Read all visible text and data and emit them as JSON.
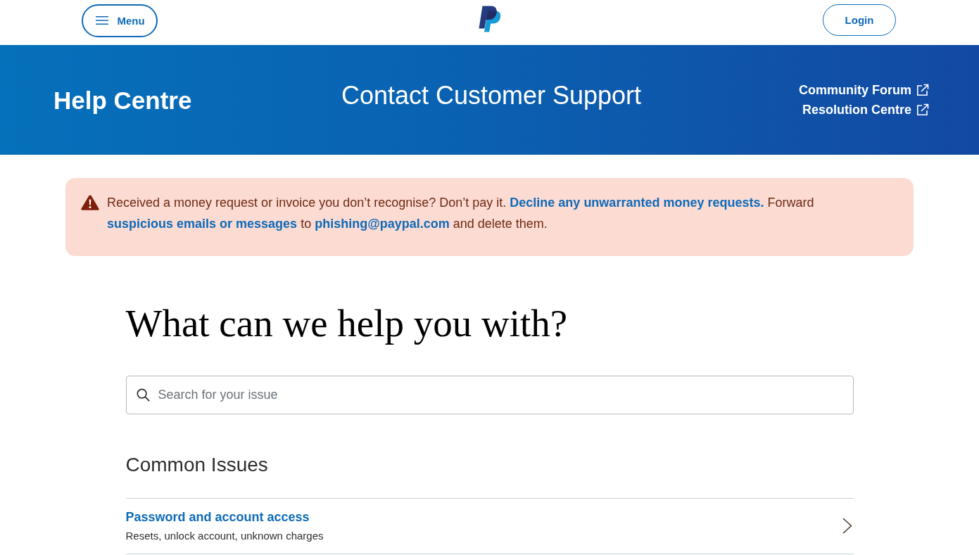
{
  "header": {
    "menu_button": {
      "label": "Menu"
    },
    "login_button": {
      "label": "Login"
    }
  },
  "banner": {
    "title": "Help Centre",
    "subtitle": "Contact Customer Support",
    "links": [
      {
        "label": "Community Forum"
      },
      {
        "label": "Resolution Centre"
      }
    ]
  },
  "alert": {
    "parts": [
      {
        "kind": "text",
        "text": "Received a money request or invoice you don’t recognise? Don’t pay it. "
      },
      {
        "kind": "link",
        "text": "Decline any unwarranted money requests."
      },
      {
        "kind": "text",
        "text": " Forward "
      },
      {
        "kind": "link",
        "text": "suspicious emails or messages"
      },
      {
        "kind": "text",
        "text": " to "
      },
      {
        "kind": "link",
        "text": "phishing@paypal.com"
      },
      {
        "kind": "text",
        "text": " and delete them."
      }
    ]
  },
  "heading": "What can we help you with?",
  "search": {
    "placeholder": "Search for your issue"
  },
  "common_issues": {
    "title": "Common Issues",
    "items": [
      {
        "title": "Password and account access",
        "description": "Resets, unlock account, unknown charges"
      }
    ]
  }
}
